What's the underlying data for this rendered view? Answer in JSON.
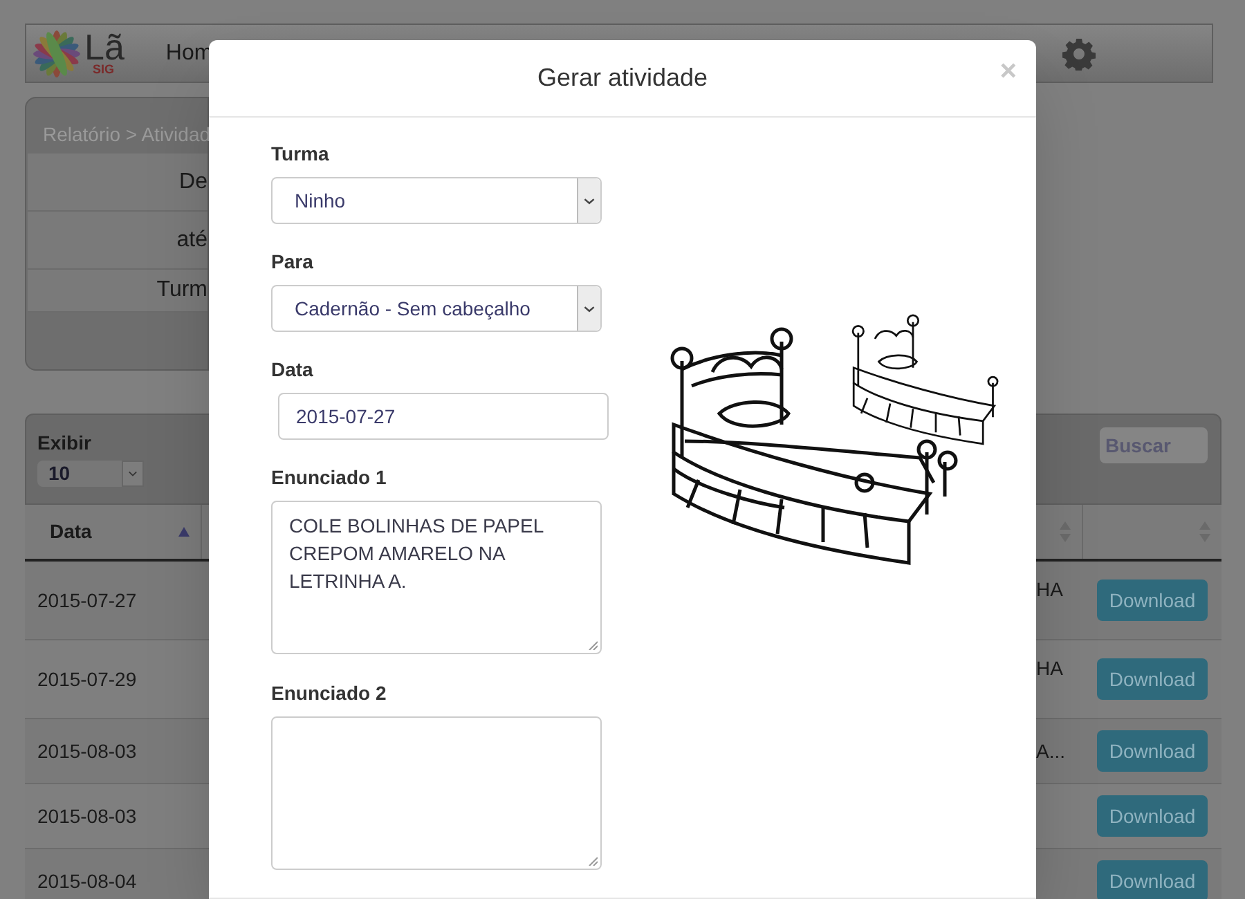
{
  "navbar": {
    "logo": {
      "text": "Lã",
      "subtext": "SIG"
    },
    "nav_items": [
      "Hom"
    ]
  },
  "filter_panel": {
    "breadcrumb": "Relatório > Atividad",
    "rows": [
      "De",
      "até",
      "Turm"
    ]
  },
  "table": {
    "length_label": "Exibir",
    "length_value": "10",
    "search_placeholder": "Buscar",
    "columns": [
      {
        "label": "Data",
        "sorted": true
      },
      {
        "sorted": false
      },
      {
        "sorted": false
      }
    ],
    "rows": [
      {
        "date": "2015-07-27",
        "column_3": "HA",
        "action": "Download"
      },
      {
        "date": "2015-07-29",
        "column_3": "HA",
        "action": "Download"
      },
      {
        "date": "2015-08-03",
        "column_3": "A...",
        "action": "Download"
      },
      {
        "date": "2015-08-03",
        "action": "Download"
      },
      {
        "date": "2015-08-04",
        "action": "Download"
      }
    ]
  },
  "modal": {
    "title": "Gerar atividade",
    "close": "×",
    "fields": [
      {
        "label": "Turma",
        "kind": "select",
        "value": "Ninho"
      },
      {
        "label": "Para",
        "kind": "select",
        "value": "Cadernão - Sem cabeçalho"
      },
      {
        "label": "Data",
        "kind": "input",
        "value": "2015-07-27"
      },
      {
        "label": "Enunciado 1",
        "kind": "textarea",
        "value": "COLE BOLINHAS DE PAPEL CREPOM AMARELO NA LETRINHA A."
      },
      {
        "label": "Enunciado 2",
        "kind": "textarea"
      }
    ]
  }
}
